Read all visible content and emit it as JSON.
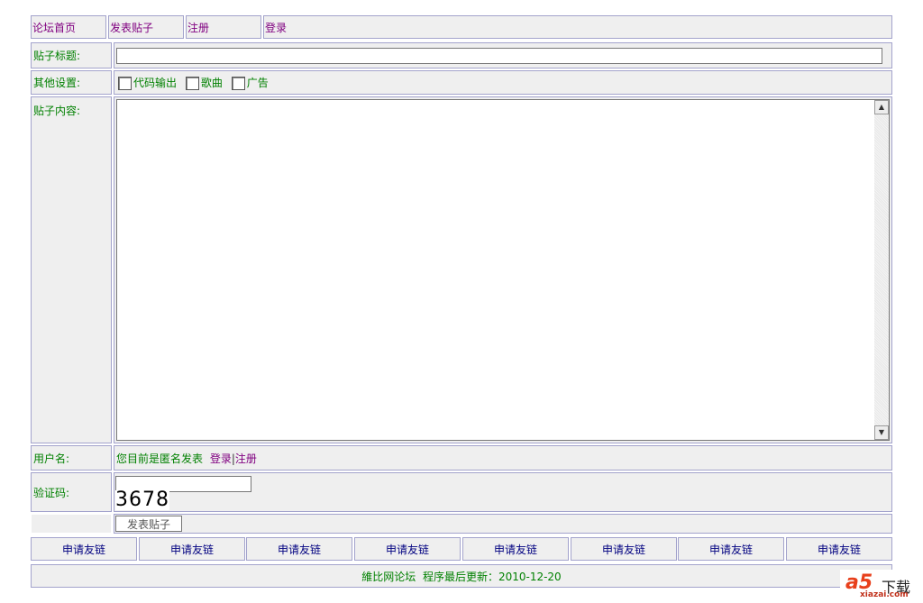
{
  "nav": [
    "论坛首页",
    "发表贴子",
    "注册",
    "登录"
  ],
  "form": {
    "title_label": "贴子标题:",
    "title_value": "",
    "settings_label": "其他设置:",
    "options": [
      "代码输出",
      "歌曲",
      "广告"
    ],
    "content_label": "贴子内容:",
    "content_value": "",
    "user_label": "用户名:",
    "anon_text": "您目前是匿名发表",
    "login_link": "登录",
    "separator": "|",
    "register_link": "注册",
    "captcha_label": "验证码:",
    "captcha_value": "",
    "captcha_code": "3678",
    "submit": "发表贴子"
  },
  "links": [
    "申请友链",
    "申请友链",
    "申请友链",
    "申请友链",
    "申请友链",
    "申请友链",
    "申请友链",
    "申请友链"
  ],
  "footer": {
    "site": "維比网论坛",
    "updated": "程序最后更新：2010-12-20"
  },
  "watermark": "a5下载 xiazai.com",
  "colors": {
    "link": "#800080",
    "label": "#008000",
    "friend_link": "#000080",
    "cell_bg": "#efefef",
    "border": "#a3a3cc"
  }
}
